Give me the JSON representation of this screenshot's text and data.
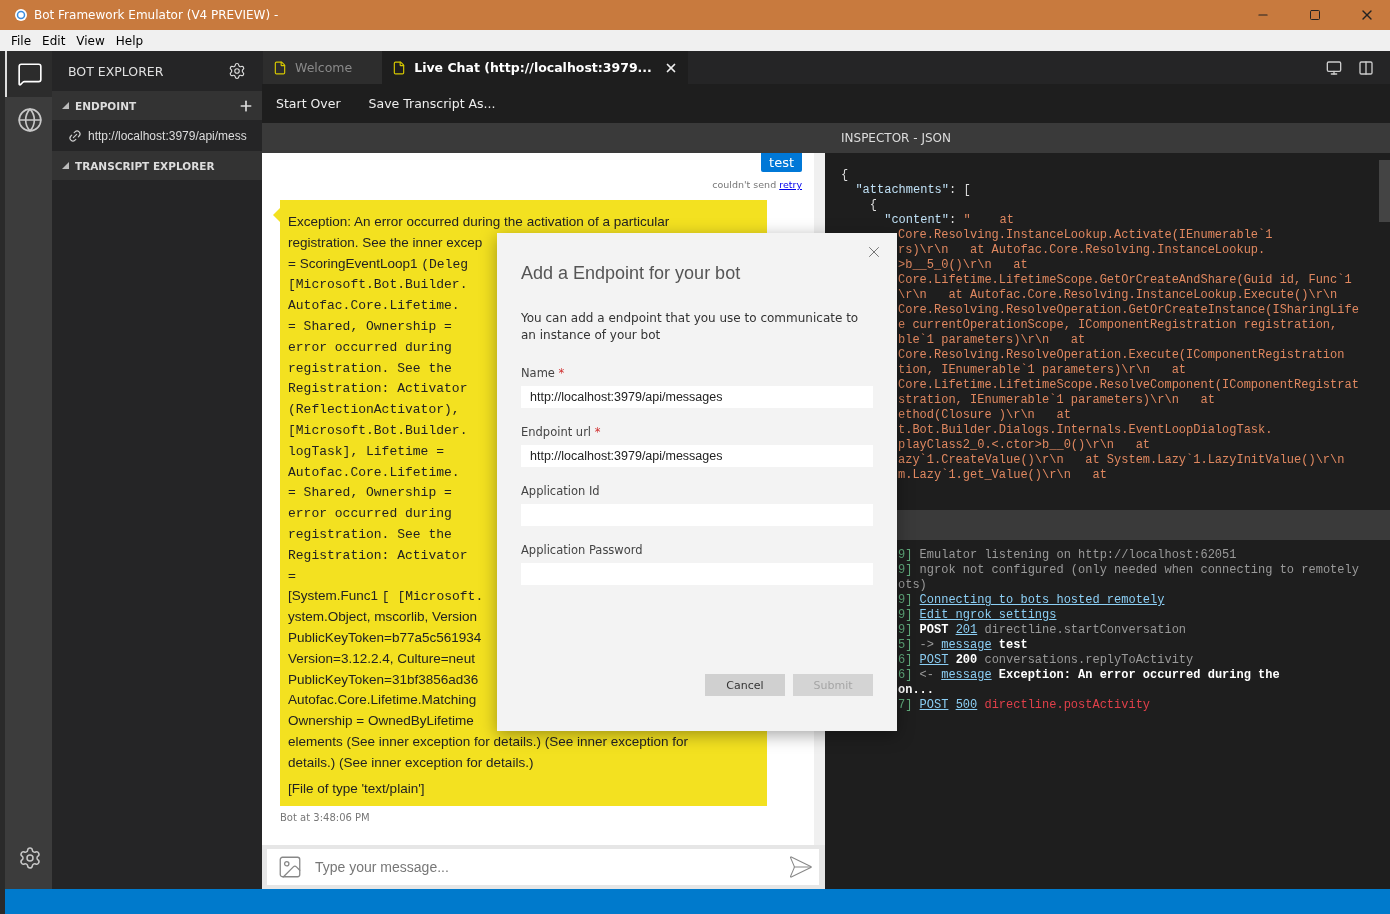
{
  "window": {
    "title": "Bot Framework Emulator (V4 PREVIEW) -"
  },
  "menu": [
    "File",
    "Edit",
    "View",
    "Help"
  ],
  "activity_bar": [
    {
      "kind": "chat",
      "selected": true
    },
    {
      "kind": "globe",
      "selected": false
    },
    {
      "kind": "settings",
      "selected": false
    }
  ],
  "sidebar": {
    "title": "BOT EXPLORER",
    "sections": [
      {
        "label": "ENDPOINT",
        "expanded": true,
        "items": [
          "http://localhost:3979/api/mess"
        ]
      },
      {
        "label": "TRANSCRIPT EXPLORER",
        "expanded": true
      }
    ]
  },
  "tabs": [
    {
      "label": "Welcome",
      "selected": false,
      "closable": false
    },
    {
      "label": "Live Chat (http://localhost:3979...",
      "selected": true,
      "closable": true
    }
  ],
  "toolbar": [
    "Start Over",
    "Save Transcript As..."
  ],
  "chat": {
    "user_message": "test",
    "send_status": "couldn't send",
    "retry": "retry",
    "bot_message": {
      "lines": [
        [
          {
            "kind": "sans",
            "text": "Exception: An error occurred during the activation of a particular"
          }
        ],
        [
          {
            "kind": "sans",
            "text": "registration. See the inner excep"
          }
        ],
        [
          {
            "kind": "sans",
            "text": "= ScoringEventLoop1 "
          },
          {
            "kind": "mono",
            "text": "(Deleg"
          }
        ],
        [
          {
            "kind": "mono",
            "text": "[Microsoft.Bot.Builder."
          }
        ],
        [
          {
            "kind": "mono",
            "text": "Autofac.Core.Lifetime."
          }
        ],
        [
          {
            "kind": "mono",
            "text": "= Shared, Ownership ="
          }
        ],
        [
          {
            "kind": "mono",
            "text": "error occurred during"
          }
        ],
        [
          {
            "kind": "mono",
            "text": "registration. See the"
          }
        ],
        [
          {
            "kind": "mono",
            "text": "Registration: Activator"
          }
        ],
        [
          {
            "kind": "mono",
            "text": "(ReflectionActivator),"
          }
        ],
        [
          {
            "kind": "mono",
            "text": "[Microsoft.Bot.Builder."
          }
        ],
        [
          {
            "kind": "mono",
            "text": "logTask], Lifetime ="
          }
        ],
        [
          {
            "kind": "mono",
            "text": "Autofac.Core.Lifetime."
          }
        ],
        [
          {
            "kind": "mono",
            "text": "= Shared, Ownership ="
          }
        ],
        [
          {
            "kind": "mono",
            "text": "error occurred during"
          }
        ],
        [
          {
            "kind": "mono",
            "text": "registration. See the"
          }
        ],
        [
          {
            "kind": "mono",
            "text": "Registration: Activator"
          }
        ],
        [
          {
            "kind": "sans",
            "text": "="
          }
        ],
        [
          {
            "kind": "sans",
            "text": "[System.Func1 "
          },
          {
            "kind": "mono",
            "text": "[ [Microsoft."
          }
        ],
        [
          {
            "kind": "sans",
            "text": "ystem.Object, mscorlib, Version"
          }
        ],
        [
          {
            "kind": "sans",
            "text": "PublicKeyToken=b77a5c561934"
          }
        ],
        [
          {
            "kind": "sans",
            "text": "Version=3.12.2.4, Culture=neut"
          }
        ],
        [
          {
            "kind": "sans",
            "text": "PublicKeyToken=31bf3856ad36"
          }
        ],
        [
          {
            "kind": "sans",
            "text": "Autofac.Core.Lifetime.Matching"
          }
        ],
        [
          {
            "kind": "sans",
            "text": "Ownership = OwnedByLifetime"
          }
        ],
        [
          {
            "kind": "sans",
            "text": "elements (See inner exception for details.) (See inner exception for"
          }
        ],
        [
          {
            "kind": "sans",
            "text": "details.) (See inner exception for details.)"
          }
        ]
      ],
      "attachment": "[File of type 'text/plain']"
    },
    "bot_timestamp": "Bot at 3:48:06 PM",
    "input": {
      "placeholder": "Type your message..."
    }
  },
  "inspector": {
    "title": "INSPECTOR - JSON",
    "json_lines": [
      {
        "kind": "full",
        "segments": [
          {
            "kind": "punct",
            "text": "{"
          }
        ]
      },
      {
        "kind": "full",
        "segments": [
          {
            "kind": "key",
            "text": "  \"attachments\""
          },
          {
            "kind": "punct",
            "text": ": ["
          }
        ]
      },
      {
        "kind": "full",
        "segments": [
          {
            "kind": "punct",
            "text": "    {"
          }
        ]
      },
      {
        "kind": "full",
        "segments": [
          {
            "kind": "key",
            "text": "      \"content\""
          },
          {
            "kind": "punct",
            "text": ": "
          },
          {
            "kind": "string",
            "text": "\"    at"
          }
        ]
      },
      {
        "kind": "clipped",
        "segments": [
          {
            "kind": "string",
            "text": "Core.Resolving.InstanceLookup.Activate(IEnumerable`1"
          }
        ]
      },
      {
        "kind": "clipped",
        "segments": [
          {
            "kind": "string",
            "text": "rs)\\r\\n   at Autofac.Core.Resolving.InstanceLookup."
          }
        ]
      },
      {
        "kind": "clipped",
        "segments": [
          {
            "kind": "string",
            "text": ">b__5_0()\\r\\n   at"
          }
        ]
      },
      {
        "kind": "clipped",
        "segments": [
          {
            "kind": "string",
            "text": "Core.Lifetime.LifetimeScope.GetOrCreateAndShare(Guid id, Func`1"
          }
        ]
      },
      {
        "kind": "clipped",
        "segments": [
          {
            "kind": "string",
            "text": "\\r\\n   at Autofac.Core.Resolving.InstanceLookup.Execute()\\r\\n"
          }
        ]
      },
      {
        "kind": "clipped",
        "segments": [
          {
            "kind": "string",
            "text": "Core.Resolving.ResolveOperation.GetOrCreateInstance(ISharingLife"
          }
        ]
      },
      {
        "kind": "clipped",
        "segments": [
          {
            "kind": "string",
            "text": "e currentOperationScope, IComponentRegistration registration,"
          }
        ]
      },
      {
        "kind": "clipped",
        "segments": [
          {
            "kind": "string",
            "text": "ble`1 parameters)\\r\\n   at"
          }
        ]
      },
      {
        "kind": "clipped",
        "segments": [
          {
            "kind": "string",
            "text": "Core.Resolving.ResolveOperation.Execute(IComponentRegistration"
          }
        ]
      },
      {
        "kind": "clipped",
        "segments": [
          {
            "kind": "string",
            "text": "tion, IEnumerable`1 parameters)\\r\\n   at"
          }
        ]
      },
      {
        "kind": "clipped",
        "segments": [
          {
            "kind": "string",
            "text": "Core.Lifetime.LifetimeScope.ResolveComponent(IComponentRegistrat"
          }
        ]
      },
      {
        "kind": "clipped",
        "segments": [
          {
            "kind": "string",
            "text": "stration, IEnumerable`1 parameters)\\r\\n   at"
          }
        ]
      },
      {
        "kind": "clipped",
        "segments": [
          {
            "kind": "string",
            "text": "ethod(Closure )\\r\\n   at"
          }
        ]
      },
      {
        "kind": "clipped",
        "segments": [
          {
            "kind": "string",
            "text": "t.Bot.Builder.Dialogs.Internals.EventLoopDialogTask."
          }
        ]
      },
      {
        "kind": "clipped",
        "segments": [
          {
            "kind": "string",
            "text": "playClass2_0.<.ctor>b__0()\\r\\n   at"
          }
        ]
      },
      {
        "kind": "clipped",
        "segments": [
          {
            "kind": "string",
            "text": "azy`1.CreateValue()\\r\\n   at System.Lazy`1.LazyInitValue()\\r\\n"
          }
        ]
      },
      {
        "kind": "clipped",
        "segments": [
          {
            "kind": "string",
            "text": "m.Lazy`1.get_Value()\\r\\n   at"
          }
        ]
      }
    ],
    "log": [
      [
        {
          "kind": "stamp",
          "text": "9]"
        },
        {
          "kind": "text",
          "text": "Emulator listening on http://localhost:62051"
        }
      ],
      [
        {
          "kind": "stamp",
          "text": "9]"
        },
        {
          "kind": "text",
          "text": "ngrok not configured (only needed when connecting to remotely"
        }
      ],
      [
        {
          "kind": "text",
          "text": "ots)"
        }
      ],
      [
        {
          "kind": "stamp",
          "text": "9]"
        },
        {
          "kind": "link",
          "text": "Connecting to bots hosted remotely"
        }
      ],
      [
        {
          "kind": "stamp",
          "text": "9]"
        },
        {
          "kind": "link",
          "text": "Edit ngrok settings"
        }
      ],
      [
        {
          "kind": "stamp",
          "text": "9]"
        },
        {
          "kind": "strong",
          "text": "POST"
        },
        {
          "kind": "link",
          "text": "201"
        },
        {
          "kind": "text",
          "text": "directline.startConversation"
        }
      ],
      [
        {
          "kind": "stamp",
          "text": "5]"
        },
        {
          "kind": "text",
          "text": "->"
        },
        {
          "kind": "link",
          "text": "message"
        },
        {
          "kind": "strong",
          "text": "test"
        }
      ],
      [
        {
          "kind": "stamp",
          "text": "6]"
        },
        {
          "kind": "link",
          "text": "POST"
        },
        {
          "kind": "strong",
          "text": "200"
        },
        {
          "kind": "text",
          "text": "conversations.replyToActivity"
        }
      ],
      [
        {
          "kind": "stamp",
          "text": "6]"
        },
        {
          "kind": "text",
          "text": "<-"
        },
        {
          "kind": "link",
          "text": "message"
        },
        {
          "kind": "strong",
          "text": "Exception: An error occurred during the"
        }
      ],
      [
        {
          "kind": "strong",
          "text": "on..."
        }
      ],
      [
        {
          "kind": "stamp",
          "text": "7]"
        },
        {
          "kind": "link",
          "text": "POST"
        },
        {
          "kind": "link",
          "text": "500"
        },
        {
          "kind": "error",
          "text": "directline.postActivity"
        }
      ]
    ]
  },
  "dialog": {
    "title": "Add a Endpoint for your bot",
    "description": "You can add a endpoint that you use to communicate to an instance of your bot",
    "fields": [
      {
        "label": "Name",
        "required_mark": "*",
        "value": "http://localhost:3979/api/messages"
      },
      {
        "label": "Endpoint url",
        "required_mark": "*",
        "value": "http://localhost:3979/api/messages"
      },
      {
        "label": "Application Id"
      },
      {
        "label": "Application Password"
      }
    ],
    "buttons": [
      {
        "label": "Cancel",
        "disabled": false
      },
      {
        "label": "Submit",
        "disabled": true
      }
    ]
  }
}
